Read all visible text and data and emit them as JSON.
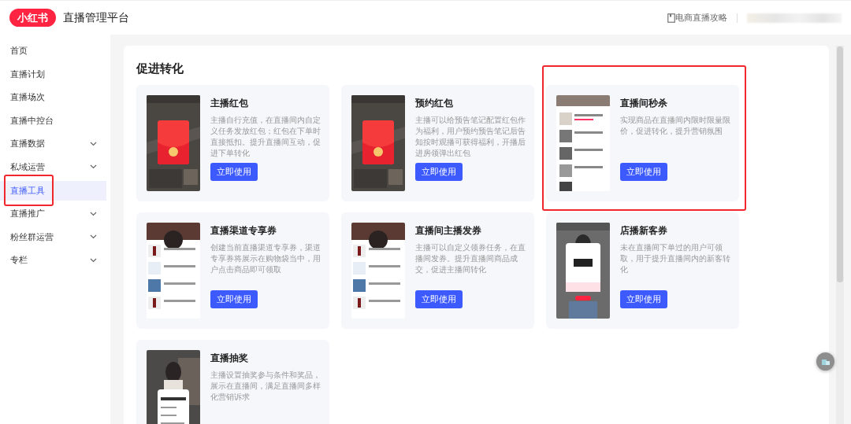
{
  "header": {
    "logo": "小红书",
    "title": "直播管理平台",
    "guide_link": "电商直播攻略"
  },
  "sidebar": {
    "items": [
      {
        "label": "首页",
        "selected": false,
        "expandable": false,
        "highlighted": false
      },
      {
        "label": "直播计划",
        "selected": false,
        "expandable": false,
        "highlighted": false
      },
      {
        "label": "直播场次",
        "selected": false,
        "expandable": false,
        "highlighted": false
      },
      {
        "label": "直播中控台",
        "selected": false,
        "expandable": false,
        "highlighted": false
      },
      {
        "label": "直播数据",
        "selected": false,
        "expandable": true,
        "highlighted": false
      },
      {
        "label": "私域运营",
        "selected": false,
        "expandable": true,
        "highlighted": false
      },
      {
        "label": "直播工具",
        "selected": true,
        "expandable": false,
        "highlighted": true
      },
      {
        "label": "直播推广",
        "selected": false,
        "expandable": true,
        "highlighted": false
      },
      {
        "label": "粉丝群运营",
        "selected": false,
        "expandable": true,
        "highlighted": false
      },
      {
        "label": "专栏",
        "selected": false,
        "expandable": true,
        "highlighted": false
      }
    ]
  },
  "section": {
    "title": "促进转化",
    "cards": [
      {
        "title": "主播红包",
        "description": "主播自行充值，在直播间内自定义任务发放红包；红包在下单时直接抵扣。提升直播间互动，促进下单转化",
        "button": "立即使用",
        "highlighted": false
      },
      {
        "title": "预约红包",
        "description": "主播可以给预告笔记配置红包作为福利，用户预约预告笔记后告知按时观播可获得福利，开播后进房领弹出红包",
        "button": "立即使用",
        "highlighted": false
      },
      {
        "title": "直播间秒杀",
        "description": "实现商品在直播间内限时限量限价，促进转化，提升营销氛围",
        "button": "立即使用",
        "highlighted": true
      },
      {
        "title": "直播渠道专享券",
        "description": "创建当前直播渠道专享券，渠道专享券将展示在购物袋当中，用户点击商品即可领取",
        "button": "立即使用",
        "highlighted": false
      },
      {
        "title": "直播间主播发券",
        "description": "主播可以自定义领券任务，在直播间发券。提升直播间商品成交，促进主播间转化",
        "button": "立即使用",
        "highlighted": false
      },
      {
        "title": "店播新客券",
        "description": "未在直播间下单过的用户可领取，用于提升直播间内的新客转化",
        "button": "立即使用",
        "highlighted": false
      },
      {
        "title": "直播抽奖",
        "description": "主播设置抽奖参与条件和奖品，展示在直播间，满足直播间多样化营销诉求",
        "highlighted": false
      }
    ]
  }
}
